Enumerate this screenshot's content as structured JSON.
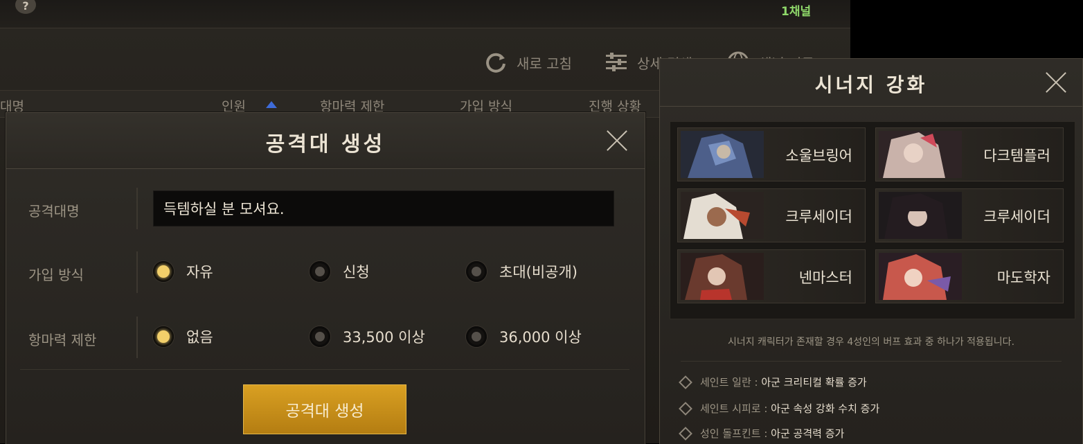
{
  "topbar": {
    "help_icon": "question-icon",
    "channel": "1채널"
  },
  "toolbar": {
    "refresh_label": "새로 고침",
    "detail_search_label": "상세 검색",
    "channel_move_label": "채널 이동"
  },
  "list_columns": [
    "대명",
    "인원",
    "항마력 제한",
    "가입 방식",
    "진행 상황"
  ],
  "create_dialog": {
    "title": "공격대 생성",
    "name_label": "공격대명",
    "name_value": "득템하실 분 모셔요.",
    "join_label": "가입 방식",
    "join_options": [
      "자유",
      "신청",
      "초대(비공개)"
    ],
    "join_selected": "자유",
    "power_label": "항마력 제한",
    "power_options": [
      "없음",
      "33,500 이상",
      "36,000 이상"
    ],
    "power_selected": "없음",
    "create_button": "공격대 생성"
  },
  "synergy_panel": {
    "title": "시너지 강화",
    "characters": [
      {
        "name": "소울브링어",
        "portrait_color": "#4d5f8a"
      },
      {
        "name": "다크템플러",
        "portrait_color": "#b79a92"
      },
      {
        "name": "크루세이더",
        "portrait_color": "#8c5a44"
      },
      {
        "name": "크루세이더",
        "portrait_color": "#3a3038"
      },
      {
        "name": "넨마스터",
        "portrait_color": "#8a4a3c"
      },
      {
        "name": "마도학자",
        "portrait_color": "#a34a45"
      }
    ],
    "description": "시너지 캐릭터가 존재할 경우 4성인의 버프 효과 중 하나가 적용됩니다.",
    "buffs": [
      {
        "name": "세인트 일란 :",
        "effect": "아군 크리티컬 확률 증가"
      },
      {
        "name": "세인트 시피로 :",
        "effect": "아군 속성 강화 수치 증가"
      },
      {
        "name": "성인 돌프킨트 :",
        "effect": "아군 공격력 증가"
      }
    ]
  },
  "colors": {
    "accent_gold": "#f2cf6a",
    "button_gold": "#c98d18",
    "channel_green": "#8fd86a"
  }
}
